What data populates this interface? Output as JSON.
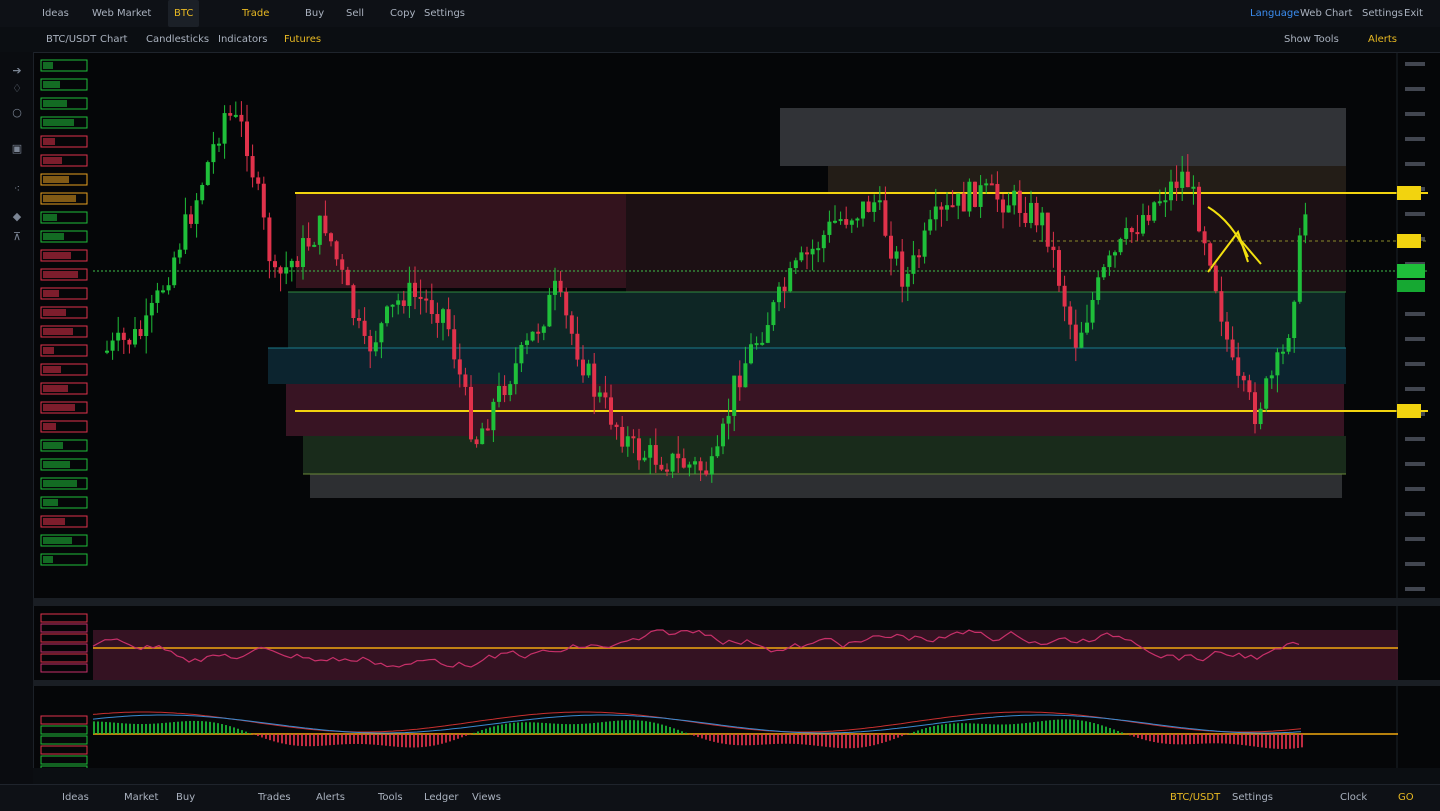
{
  "topbar": {
    "items": [
      "Ideas",
      "Web Market",
      "BTC",
      "Trade",
      "Buy",
      "Sell",
      "Copy",
      "Settings"
    ],
    "right": [
      "Language",
      "Web Chart",
      "Settings",
      "Exit"
    ]
  },
  "subbar": {
    "items": [
      "BTC/USDT",
      "Chart",
      "Candlesticks",
      "Indicators",
      "Futures"
    ],
    "right": [
      "Show Tools",
      "Alerts"
    ]
  },
  "bottombar": {
    "items": [
      "Ideas",
      "Market",
      "Buy",
      "Trades",
      "Alerts",
      "Tools",
      "Ledger",
      "Views"
    ],
    "right": [
      "BTC/USDT",
      "Settings",
      "Clock",
      "GO"
    ]
  },
  "colors": {
    "up": "#1fbf3a",
    "down": "#e0324b",
    "level": "#f2d30f",
    "background": "#050608"
  },
  "icons": [
    "arrow-icon",
    "pin-icon",
    "circle-icon",
    "layers-icon",
    "scatter-icon",
    "measure-icon",
    "text-icon"
  ]
}
